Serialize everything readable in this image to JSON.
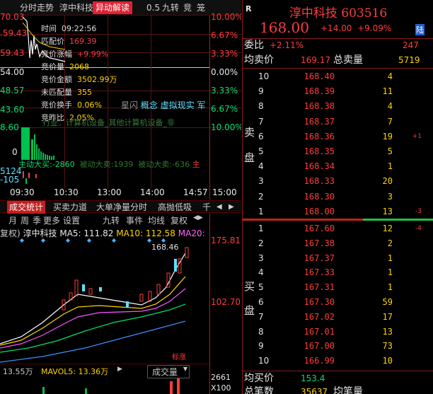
{
  "top_tabs": [
    "分时走势",
    "淳中科技",
    "异动解读",
    "0.5",
    "九转",
    "竞",
    "笼"
  ],
  "intraday": {
    "price_ticks": [
      "70.03",
      ".59.43",
      "59.43",
      "54.00",
      "48.57",
      "43.60",
      "8.60"
    ],
    "pct_ticks": [
      "10.00%",
      "6.67%",
      "3.33%",
      "0.00%",
      "3.33%",
      "6.67%",
      "10.00%"
    ],
    "vol_ticks": [
      "0",
      "5124",
      "-105"
    ],
    "time_ticks": [
      "09:30",
      "10:30",
      "13:00",
      "14:00",
      "14:57",
      "15:00"
    ],
    "flow_row": {
      "label1": "主动大买",
      "val1": "-2860",
      "label2": "被动大卖",
      "val2": "1939",
      "label3": "被动大卖",
      "val3": "-636",
      "tail": "主"
    }
  },
  "tooltip": {
    "time_label": "时间",
    "time": "09:22:56",
    "match_label": "匹配价",
    "match": "169.39",
    "bid_chg_label": "竞价涨幅",
    "bid_chg": "+9.99%",
    "bid_vol_label": "竞价量",
    "bid_vol": "2068",
    "bid_amt_label": "竞价金额",
    "bid_amt": "3502.99万",
    "unmatched_label": "未匹配量",
    "unmatched": "355",
    "turnover_label": "竞价换手",
    "turnover": "0.06%",
    "prev_label": "竞昨比",
    "prev": "2.05%",
    "concept_prefix": "星闪",
    "concept_link1": "概念",
    "concept_link2": "虚拟现实",
    "concept_link3": "军",
    "industry": "行业：计算机设备_其他计算机设备_非"
  },
  "bottom_tabs": [
    "成交统计",
    "买卖力道",
    "大单净量分时",
    "高抛低吸",
    "千",
    "◀",
    "▶"
  ],
  "kline_toolbar": [
    "月",
    "周",
    "季",
    "更多",
    "设置",
    "九转",
    "事件",
    "均线",
    "复权",
    "◀▶"
  ],
  "ma_row": {
    "prefix": "复权)",
    "name": "淳中科技",
    "ma5": "MA5: 111.82",
    "ma10": "MA10: 112.58",
    "ma20": "MA20:"
  },
  "kline": {
    "hi_label": "168.46",
    "tick_top": "175.81",
    "tick_mid": "102.70",
    "limit": "标涨"
  },
  "mavol": {
    "val": "13.55万",
    "ma5": "MAVOL5: 13.36万",
    "sel": "成交量",
    "t1": "2661",
    "t2": "X100"
  },
  "quote": {
    "code_mark": "R",
    "name": "淳中科技",
    "code": "603516",
    "price": "168.00",
    "change": "+14.00",
    "pct": "+9.09%",
    "tag": "陆",
    "weibi_label": "委比",
    "weibi": "+2.11%",
    "weicha": "247",
    "avg_sell_label": "均卖价",
    "avg_sell": "169.17",
    "total_sell_label": "总卖量",
    "total_sell": "5719",
    "sell_side_label": [
      "卖",
      "盘"
    ],
    "buy_side_label": [
      "买",
      "盘"
    ],
    "avg_buy_label": "均买价",
    "avg_buy": "153.4",
    "bottom_label": "总笔数",
    "bottom_val": "35637",
    "bottom_label2": "均笔量"
  },
  "asks": [
    {
      "lvl": "10",
      "price": "168.40",
      "vol": "4",
      "chg": ""
    },
    {
      "lvl": "9",
      "price": "168.39",
      "vol": "11",
      "chg": ""
    },
    {
      "lvl": "8",
      "price": "168.38",
      "vol": "4",
      "chg": ""
    },
    {
      "lvl": "7",
      "price": "168.37",
      "vol": "7",
      "chg": ""
    },
    {
      "lvl": "6",
      "price": "168.36",
      "vol": "19",
      "chg": "+1"
    },
    {
      "lvl": "5",
      "price": "168.35",
      "vol": "5",
      "chg": ""
    },
    {
      "lvl": "4",
      "price": "168.34",
      "vol": "1",
      "chg": ""
    },
    {
      "lvl": "3",
      "price": "168.33",
      "vol": "20",
      "chg": ""
    },
    {
      "lvl": "2",
      "price": "168.30",
      "vol": "3",
      "chg": ""
    },
    {
      "lvl": "1",
      "price": "168.00",
      "vol": "13",
      "chg": "-3"
    }
  ],
  "bids": [
    {
      "lvl": "1",
      "price": "167.60",
      "vol": "12",
      "chg": "-4"
    },
    {
      "lvl": "2",
      "price": "167.38",
      "vol": "2",
      "chg": ""
    },
    {
      "lvl": "3",
      "price": "167.37",
      "vol": "1",
      "chg": ""
    },
    {
      "lvl": "4",
      "price": "167.33",
      "vol": "1",
      "chg": ""
    },
    {
      "lvl": "5",
      "price": "167.31",
      "vol": "1",
      "chg": ""
    },
    {
      "lvl": "6",
      "price": "167.30",
      "vol": "59",
      "chg": ""
    },
    {
      "lvl": "7",
      "price": "167.02",
      "vol": "17",
      "chg": ""
    },
    {
      "lvl": "8",
      "price": "167.01",
      "vol": "13",
      "chg": ""
    },
    {
      "lvl": "9",
      "price": "167.00",
      "vol": "73",
      "chg": ""
    },
    {
      "lvl": "10",
      "price": "166.99",
      "vol": "10",
      "chg": ""
    }
  ],
  "colors": {
    "up": "#ff3c3c",
    "down": "#00e070",
    "accent": "#d22222",
    "bg": "#000000",
    "volume": "#ffd400"
  }
}
